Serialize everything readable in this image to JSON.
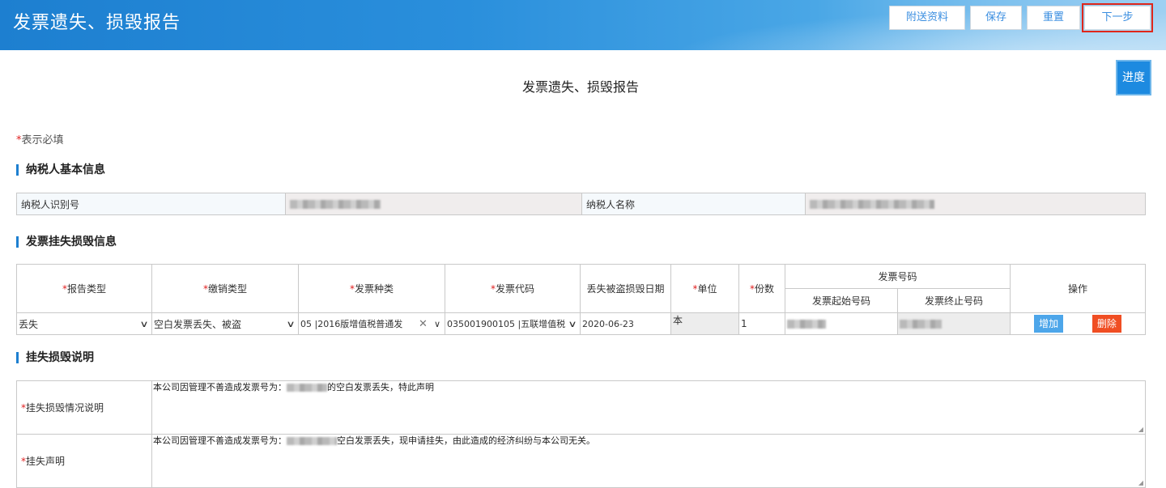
{
  "header": {
    "title": "发票遗失、损毁报告",
    "buttons": {
      "attach": "附送资料",
      "save": "保存",
      "reset": "重置",
      "next": "下一步"
    },
    "progress": "进度"
  },
  "form_title": "发票遗失、损毁报告",
  "required_note": "表示必填",
  "sections": {
    "basic_info": "纳税人基本信息",
    "invoice_info": "发票挂失损毁信息",
    "description": "挂失损毁说明"
  },
  "basic_info": {
    "taxpayer_id_label": "纳税人识别号",
    "taxpayer_name_label": "纳税人名称"
  },
  "invoice_table": {
    "headers": {
      "report_type": "报告类型",
      "cancel_type": "缴销类型",
      "invoice_kind": "发票种类",
      "invoice_code": "发票代码",
      "loss_date": "丢失被盗损毁日期",
      "unit": "单位",
      "copies": "份数",
      "invoice_number": "发票号码",
      "start_number": "发票起始号码",
      "end_number": "发票终止号码",
      "actions": "操作"
    },
    "row": {
      "report_type": "丢失",
      "cancel_type": "空白发票丢失、被盗",
      "invoice_kind": "05 |2016版增值税普通发",
      "invoice_code": "035001900105 |五联增值税",
      "loss_date": "2020-06-23",
      "unit": "本",
      "copies": "1",
      "add": "增加",
      "delete": "删除"
    }
  },
  "description": {
    "loss_label": "挂失损毁情况说明",
    "loss_text_a": "本公司因管理不善造成发票号为：",
    "loss_text_b": "的空白发票丢失，特此声明",
    "statement_label": "挂失声明",
    "statement_text_a": "本公司因管理不善造成发票号为：",
    "statement_text_b": "空白发票丢失，现申请挂失，由此造成的经济纠纷与本公司无关。"
  }
}
